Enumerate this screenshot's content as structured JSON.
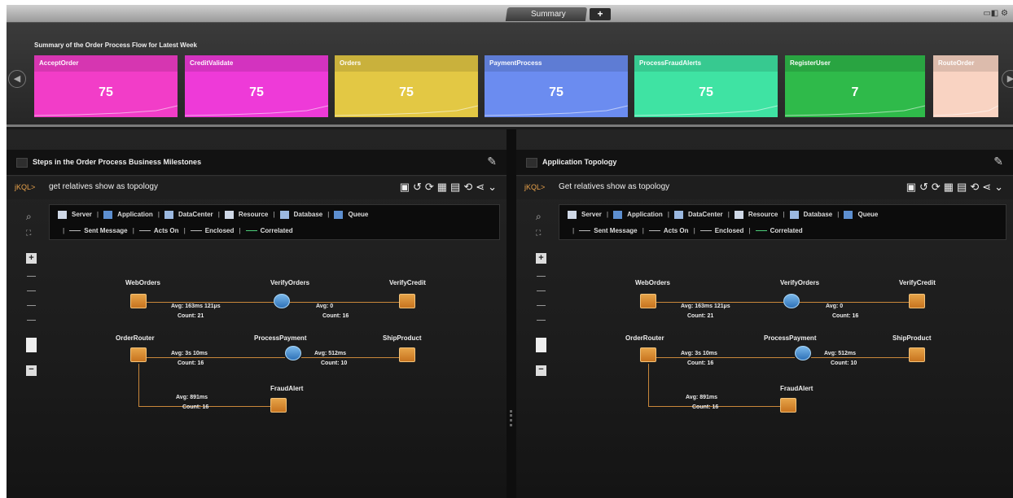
{
  "tabs": {
    "summary_label": "Summary",
    "add_label": "+",
    "window_controls": "▭◧ ⚙"
  },
  "summary": {
    "title": "Summary of the Order Process Flow for Latest Week",
    "prev_label": "◀",
    "next_label": "▶",
    "cards": [
      {
        "name": "AcceptOrder",
        "value": "75",
        "color": "#f23dc8"
      },
      {
        "name": "CreditValidate",
        "value": "75",
        "color": "#ee3ad8"
      },
      {
        "name": "Orders",
        "value": "75",
        "color": "#e3c844"
      },
      {
        "name": "PaymentProcess",
        "value": "75",
        "color": "#6b8cf0"
      },
      {
        "name": "ProcessFraudAlerts",
        "value": "75",
        "color": "#3fe3a3"
      },
      {
        "name": "RegisterUser",
        "value": "7",
        "color": "#2fba4a"
      },
      {
        "name": "RouteOrder",
        "value": "",
        "color": "#f9d3c2"
      }
    ]
  },
  "panels": [
    {
      "title": "Steps in the Order Process Business Milestones",
      "jql_prefix": "jKQL>",
      "query": "get relatives show as topology"
    },
    {
      "title": "Application Topology",
      "jql_prefix": "jKQL>",
      "query": "Get relatives show as topology"
    }
  ],
  "legend": {
    "types": [
      "Server",
      "Application",
      "DataCenter",
      "Resource",
      "Database",
      "Queue"
    ],
    "links": [
      "Sent Message",
      "Acts On",
      "Enclosed",
      "Correlated"
    ]
  },
  "topology": {
    "nodes": [
      "WebOrders",
      "VerifyOrders",
      "VerifyCredit",
      "OrderRouter",
      "ProcessPayment",
      "ShipProduct",
      "FraudAlert"
    ],
    "edges": [
      {
        "avg": "Avg: 163ms 121µs",
        "count": "Count: 21"
      },
      {
        "avg": "Avg: 0",
        "count": "Count: 16"
      },
      {
        "avg": "Avg: 3s 10ms",
        "count": "Count: 16"
      },
      {
        "avg": "Avg: 512ms",
        "count": "Count: 10"
      },
      {
        "avg": "Avg: 891ms",
        "count": "Count: 16"
      }
    ]
  },
  "toolbar_icons": [
    "terminal-icon",
    "undo-icon",
    "refresh-icon",
    "chart-icon",
    "calendar-icon",
    "sync-icon",
    "share-icon",
    "chevron-down-icon"
  ]
}
